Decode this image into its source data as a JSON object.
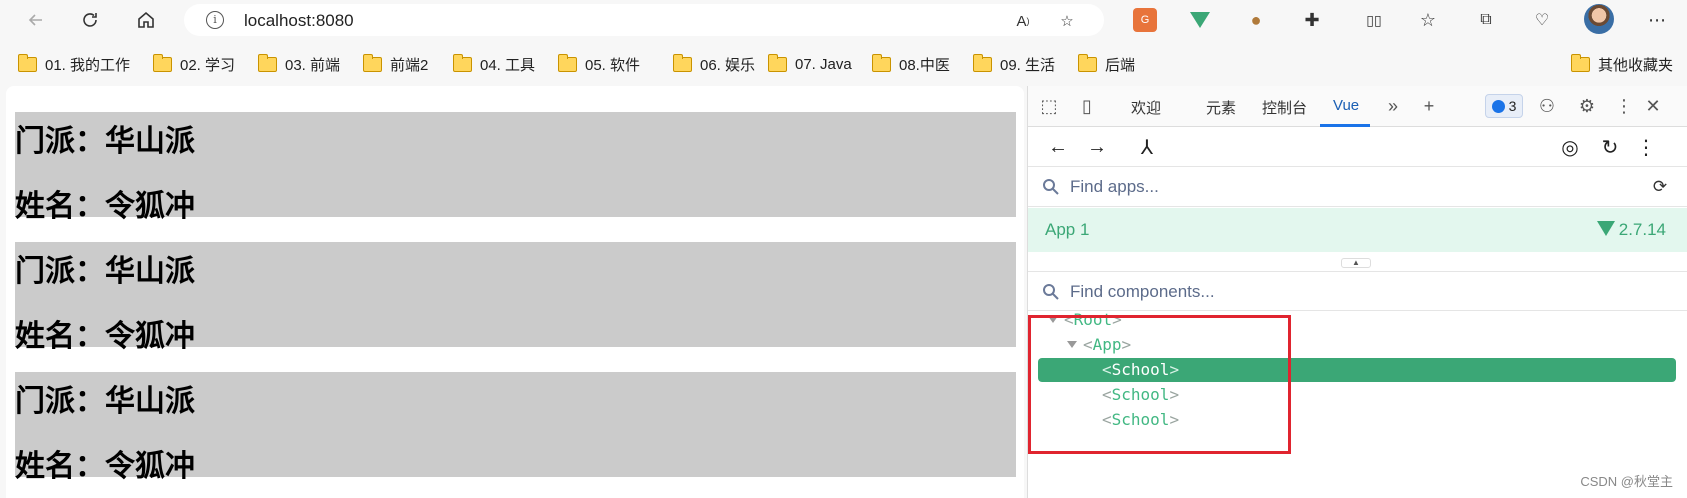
{
  "browser": {
    "address": "localhost:8080",
    "bookmarks": [
      "01. 我的工作",
      "02. 学习",
      "03. 前端",
      "前端2",
      "04. 工具",
      "05. 软件",
      "06. 娱乐",
      "07. Java",
      "08.中医",
      "09. 生活",
      "后端"
    ],
    "other_bookmarks": "其他收藏夹"
  },
  "page": {
    "schools": [
      {
        "name_line": "门派：华山派",
        "person_line": "姓名：令狐冲"
      },
      {
        "name_line": "门派：华山派",
        "person_line": "姓名：令狐冲"
      },
      {
        "name_line": "门派：华山派",
        "person_line": "姓名：令狐冲"
      }
    ]
  },
  "devtools": {
    "tabs": [
      "欢迎",
      "元素",
      "控制台",
      "Vue"
    ],
    "active_tab": "Vue",
    "issues_count": "3",
    "find_apps_placeholder": "Find apps...",
    "app_name": "App 1",
    "vue_version": "2.7.14",
    "find_components_placeholder": "Find components...",
    "tree": [
      {
        "label": "Root",
        "depth": 0,
        "expanded": true,
        "selected": false
      },
      {
        "label": "App",
        "depth": 1,
        "expanded": true,
        "selected": false
      },
      {
        "label": "School",
        "depth": 2,
        "expanded": false,
        "selected": true
      },
      {
        "label": "School",
        "depth": 2,
        "expanded": false,
        "selected": false
      },
      {
        "label": "School",
        "depth": 2,
        "expanded": false,
        "selected": false
      }
    ],
    "accent_color": "#3ba776"
  },
  "watermark": "CSDN @秋堂主"
}
